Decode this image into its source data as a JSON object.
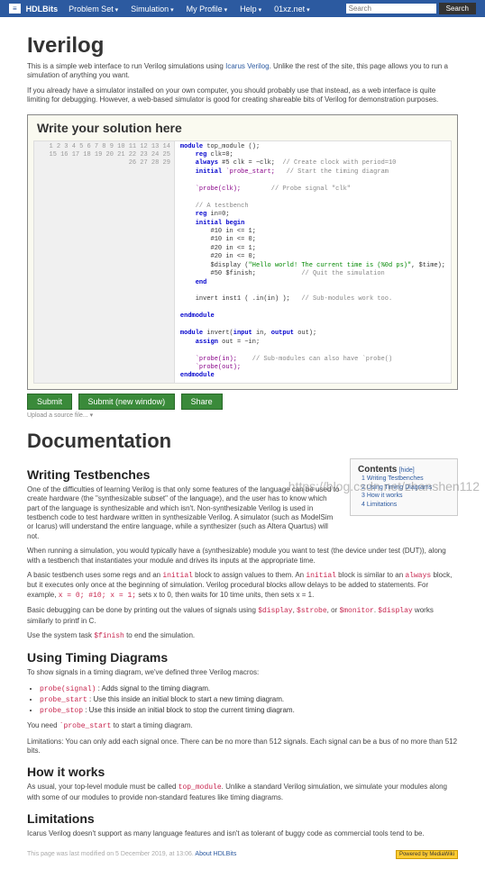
{
  "nav": {
    "logo": "≡",
    "brand": "HDLBits",
    "items": [
      "Problem Set",
      "Simulation",
      "My Profile",
      "Help",
      "01xz.net"
    ],
    "search_placeholder": "Search",
    "search_btn": "Search"
  },
  "page": {
    "title": "Iverilog",
    "intro1_a": "This is a simple web interface to run Verilog simulations using ",
    "intro1_link": "Icarus Verilog",
    "intro1_b": ". Unlike the rest of the site, this page allows you to run a simulation of anything you want.",
    "intro2": "If you already have a simulator installed on your own computer, you should probably use that instead, as a web interface is quite limiting for debugging. However, a web-based simulator is good for creating shareable bits of Verilog for demonstration purposes."
  },
  "editor": {
    "header": "Write your solution here",
    "gutter": "1\n2\n3\n4\n5\n6\n7\n8\n9\n10\n11\n12\n13\n14\n15\n16\n17\n18\n19\n20\n21\n22\n23\n24\n25\n26\n27\n28\n29",
    "line1a": "module",
    "line1b": " top_module ();",
    "line2a": "    reg",
    "line2b": " clk=0;",
    "line3a": "    always",
    "line3b": " #5 clk = ~clk;  ",
    "line3c": "// Create clock with period=10",
    "line4a": "    initial",
    "line4b": " `probe_start;   ",
    "line4c": "// Start the timing diagram",
    "line5": "",
    "line6a": "    `probe(clk);        ",
    "line6c": "// Probe signal \"clk\"",
    "line7": "",
    "line8c": "    // A testbench",
    "line9a": "    reg",
    "line9b": " in=0;",
    "line10a": "    initial begin",
    "line11": "        #10 in <= 1;",
    "line12": "        #10 in <= 0;",
    "line13": "        #20 in <= 1;",
    "line14": "        #20 in <= 0;",
    "line15a": "        $display (",
    "line15s": "\"Hello world! The current time is (%0d ps)\"",
    "line15b": ", $time);",
    "line16a": "        #50 $finish;            ",
    "line16c": "// Quit the simulation",
    "line17a": "    end",
    "line18": "",
    "line19a": "    invert inst1 ( .in(in) );   ",
    "line19c": "// Sub-modules work too.",
    "line20": "",
    "line21a": "endmodule",
    "line22": "",
    "line23a": "module",
    "line23b": " invert(",
    "line23c": "input",
    "line23d": " in, ",
    "line23e": "output",
    "line23f": " out);",
    "line24a": "    assign",
    "line24b": " out = ~in;",
    "line25": "",
    "line26a": "    `probe(in);    ",
    "line26c": "// Sub-modules can also have `probe()",
    "line27": "    `probe(out);",
    "line28a": "endmodule",
    "line29": ""
  },
  "buttons": {
    "submit": "Submit",
    "submit_new": "Submit (new window)",
    "share": "Share"
  },
  "upload_note": "Upload a source file...  ▾",
  "doc": {
    "title": "Documentation",
    "toc_title": "Contents",
    "toc_hide": "[hide]",
    "toc_items": [
      "1 Writing Testbenches",
      "2 Using Timing Diagrams",
      "3 How it works",
      "4 Limitations"
    ],
    "s1_h": "Writing Testbenches",
    "s1_p1": "One of the difficulties of learning Verilog is that only some features of the language can be used to create hardware (the \"synthesizable subset\" of the language), and the user has to know which part of the language is synthesizable and which isn't. Non-synthesizable Verilog is used in testbench code to test hardware written in synthesizable Verilog. A simulator (such as ModelSim or Icarus) will understand the entire language, while a synthesizer (such as Altera Quartus) will not.",
    "s1_p2": "When running a simulation, you would typically have a (synthesizable) module you want to test (the device under test (DUT)), along with a testbench that instantiates your module and drives its inputs at the appropriate time.",
    "s1_p3_a": "A basic testbench uses some regs and an ",
    "s1_p3_code1": "initial",
    "s1_p3_b": " block to assign values to them. An ",
    "s1_p3_code2": "initial",
    "s1_p3_c": " block is similar to an ",
    "s1_p3_code3": "always",
    "s1_p3_d": " block, but it executes only once at the beginning of simulation. Verilog procedural blocks allow delays to be added to statements. For example, ",
    "s1_p3_code4": "x = 0; #10; x = 1;",
    "s1_p3_e": " sets x to 0, then waits for 10 time units, then sets x = 1.",
    "s1_p4_a": "Basic debugging can be done by printing out the values of signals using ",
    "s1_p4_code1": "$display",
    "s1_p4_b": ", ",
    "s1_p4_code2": "$strobe",
    "s1_p4_c": ", or ",
    "s1_p4_code3": "$monitor",
    "s1_p4_d": ". ",
    "s1_p4_code4": "$display",
    "s1_p4_e": " works similarly to printf in C.",
    "s1_p5_a": "Use the system task ",
    "s1_p5_code": "$finish",
    "s1_p5_b": " to end the simulation.",
    "s2_h": "Using Timing Diagrams",
    "s2_p1": "To show signals in a timing diagram, we've defined three Verilog macros:",
    "s2_li1_code": "probe(signal)",
    "s2_li1_txt": " : Adds signal to the timing diagram.",
    "s2_li2_code": "probe_start",
    "s2_li2_txt": " : Use this inside an initial block to start a new timing diagram.",
    "s2_li3_code": "probe_stop",
    "s2_li3_txt": " : Use this inside an initial block to stop the current timing diagram.",
    "s2_p2_a": "You need ",
    "s2_p2_code": "`probe_start",
    "s2_p2_b": " to start a timing diagram.",
    "s2_p3": "Limitations: You can only add each signal once. There can be no more than 512 signals. Each signal can be a bus of no more than 512 bits.",
    "s3_h": "How it works",
    "s3_p1_a": "As usual, your top-level module must be called ",
    "s3_p1_code": "top_module",
    "s3_p1_b": ". Unlike a standard Verilog simulation, we simulate your modules along with some of our modules to provide non-standard features like timing diagrams.",
    "s4_h": "Limitations",
    "s4_p1": "Icarus Verilog doesn't support as many language features and isn't as tolerant of buggy code as commercial tools tend to be."
  },
  "footer": {
    "text": "This page was last modified on 5 December 2019, at 13:06.",
    "about": "About HDLBits",
    "badge": "Powered by MediaWiki"
  },
  "watermark": "https://blog.csdn.net/zhanshen112"
}
